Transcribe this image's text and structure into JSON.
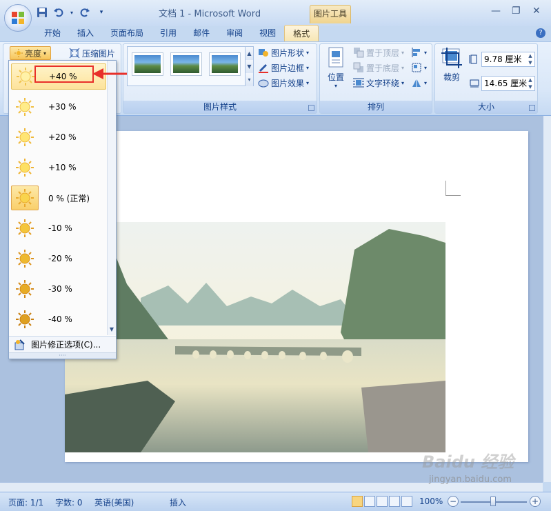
{
  "window": {
    "title": "文档 1 - Microsoft Word",
    "context_tab": "图片工具"
  },
  "tabs": [
    "开始",
    "插入",
    "页面布局",
    "引用",
    "邮件",
    "审阅",
    "视图",
    "格式"
  ],
  "active_tab": "格式",
  "ribbon": {
    "adjust": {
      "brightness_label": "亮度",
      "compress_label": "压缩图片"
    },
    "picture_styles": {
      "label": "图片样式",
      "shape_label": "图片形状",
      "border_label": "图片边框",
      "effects_label": "图片效果"
    },
    "arrange": {
      "label": "排列",
      "position_label": "位置",
      "bring_front_label": "置于顶层",
      "send_back_label": "置于底层",
      "text_wrap_label": "文字环绕"
    },
    "size": {
      "label": "大小",
      "crop_label": "裁剪",
      "height_value": "9.78 厘米",
      "width_value": "14.65 厘米"
    }
  },
  "brightness_menu": {
    "items": [
      {
        "label": "+40 %",
        "level": 40
      },
      {
        "label": "+30 %",
        "level": 30
      },
      {
        "label": "+20 %",
        "level": 20
      },
      {
        "label": "+10 %",
        "level": 10
      },
      {
        "label": "0 % (正常)",
        "level": 0
      },
      {
        "label": "-10 %",
        "level": -10
      },
      {
        "label": "-20 %",
        "level": -20
      },
      {
        "label": "-30 %",
        "level": -30
      },
      {
        "label": "-40 %",
        "level": -40
      }
    ],
    "hovered": "+40 %",
    "selected": "0 % (正常)",
    "footer_label": "图片修正选项(C)..."
  },
  "statusbar": {
    "page": "页面: 1/1",
    "words": "字数: 0",
    "language": "英语(美国)",
    "mode": "插入",
    "zoom": "100%"
  },
  "watermark": {
    "brand": "Baidu 经验",
    "url": "jingyan.baidu.com"
  },
  "colors": {
    "ribbon_blue": "#dde9f8",
    "highlight_orange": "#f7c55a",
    "callout_red": "#e8302a"
  }
}
